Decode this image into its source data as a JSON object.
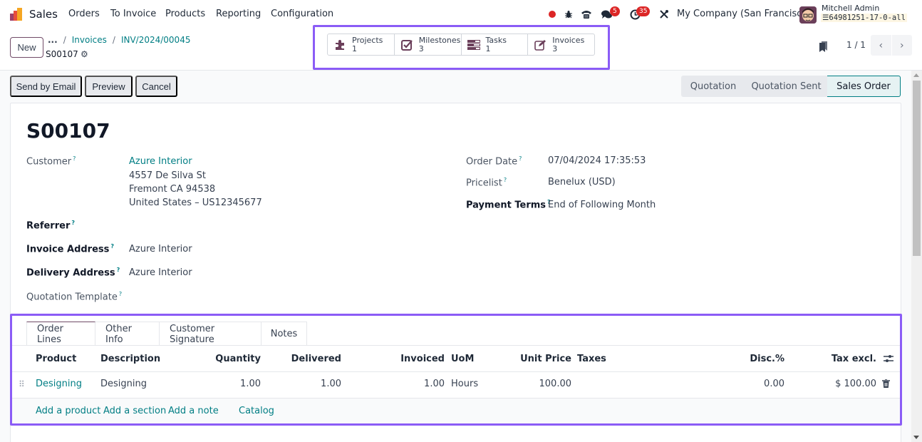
{
  "navbar": {
    "app_name": "Sales",
    "menu": [
      "Orders",
      "To Invoice",
      "Products",
      "Reporting",
      "Configuration"
    ],
    "icons": [
      "recording-dot-icon",
      "bug-icon",
      "phone-icon",
      "chat-icon",
      "activity-clock-icon",
      "tools-icon"
    ],
    "messages_badge": "5",
    "activities_badge": "35",
    "company": "My Company (San Francisco)",
    "user_name": "Mitchell Admin",
    "database": "64981251-17-0-all"
  },
  "control_panel": {
    "new_label": "New",
    "breadcrumb": [
      "...",
      "Invoices",
      "INV/2024/00045"
    ],
    "record_name": "S00107",
    "smart_buttons": [
      {
        "icon": "puzzle-icon",
        "label": "Projects",
        "count": "1"
      },
      {
        "icon": "checkbox-icon",
        "label": "Milestones",
        "count": "3"
      },
      {
        "icon": "tasks-icon",
        "label": "Tasks",
        "count": "1"
      },
      {
        "icon": "edit-icon",
        "label": "Invoices",
        "count": "3"
      }
    ],
    "pager": "1 / 1"
  },
  "actions": {
    "send_email": "Send by Email",
    "preview": "Preview",
    "cancel": "Cancel"
  },
  "status_stages": [
    "Quotation",
    "Quotation Sent",
    "Sales Order"
  ],
  "active_stage": "Sales Order",
  "form": {
    "title": "S00107",
    "customer_label": "Customer",
    "customer_name": "Azure Interior",
    "customer_address": [
      "4557 De Silva St",
      "Fremont CA 94538",
      "United States – US12345677"
    ],
    "referrer_label": "Referrer",
    "invoice_address_label": "Invoice Address",
    "invoice_address": "Azure Interior",
    "delivery_address_label": "Delivery Address",
    "delivery_address": "Azure Interior",
    "quotation_template_label": "Quotation Template",
    "order_date_label": "Order Date",
    "order_date": "07/04/2024 17:35:53",
    "pricelist_label": "Pricelist",
    "pricelist": "Benelux (USD)",
    "payment_terms_label": "Payment Terms",
    "payment_terms": "End of Following Month",
    "help_mark": "?"
  },
  "tabs": [
    "Order Lines",
    "Other Info",
    "Customer Signature",
    "Notes"
  ],
  "order_lines": {
    "columns": [
      "Product",
      "Description",
      "Quantity",
      "Delivered",
      "Invoiced",
      "UoM",
      "Unit Price",
      "Taxes",
      "Disc.%",
      "Tax excl."
    ],
    "rows": [
      {
        "product": "Designing",
        "description": "Designing",
        "quantity": "1.00",
        "delivered": "1.00",
        "invoiced": "1.00",
        "uom": "Hours",
        "unit_price": "100.00",
        "taxes": "",
        "discount": "0.00",
        "subtotal": "$ 100.00"
      }
    ],
    "add_links": [
      "Add a product",
      "Add a section",
      "Add a note",
      "Catalog"
    ]
  }
}
